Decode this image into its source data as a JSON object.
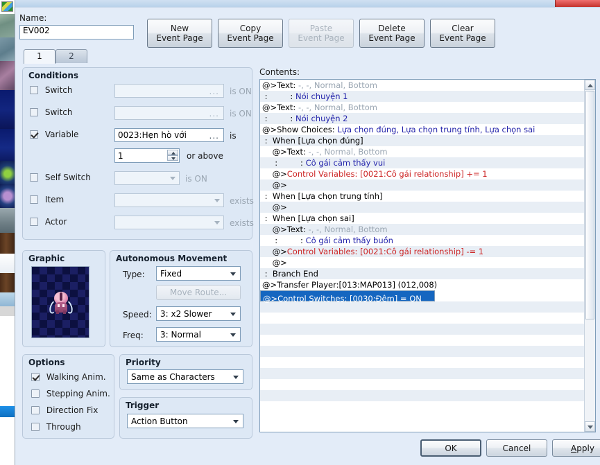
{
  "window": {
    "name_label": "Name:",
    "name_value": "EV002"
  },
  "toolbar": {
    "buttons": [
      {
        "line1": "New",
        "line2": "Event Page",
        "disabled": false
      },
      {
        "line1": "Copy",
        "line2": "Event Page",
        "disabled": false
      },
      {
        "line1": "Paste",
        "line2": "Event Page",
        "disabled": true
      },
      {
        "line1": "Delete",
        "line2": "Event Page",
        "disabled": false
      },
      {
        "line1": "Clear",
        "line2": "Event Page",
        "disabled": false
      }
    ]
  },
  "tabs": [
    {
      "label": "1",
      "active": true
    },
    {
      "label": "2",
      "active": false
    }
  ],
  "conditions": {
    "title": "Conditions",
    "rows": [
      {
        "label": "Switch",
        "checked": false,
        "value": "",
        "suffix": "is ON"
      },
      {
        "label": "Switch",
        "checked": false,
        "value": "",
        "suffix": "is ON"
      },
      {
        "label": "Variable",
        "checked": true,
        "value": "0023:Hẹn hò với",
        "suffix": "is"
      },
      {
        "label": "Self Switch",
        "checked": false,
        "value": "",
        "suffix": "is ON"
      },
      {
        "label": "Item",
        "checked": false,
        "value": "",
        "suffix": "exists"
      },
      {
        "label": "Actor",
        "checked": false,
        "value": "",
        "suffix": "exists"
      }
    ],
    "variable_amount": "1",
    "variable_comparison": "or above",
    "ellipsis": "..."
  },
  "graphic": {
    "title": "Graphic"
  },
  "movement": {
    "title": "Autonomous Movement",
    "type_label": "Type:",
    "type_value": "Fixed",
    "move_route_button": "Move Route...",
    "speed_label": "Speed:",
    "speed_value": "3: x2 Slower",
    "freq_label": "Freq:",
    "freq_value": "3: Normal"
  },
  "options": {
    "title": "Options",
    "items": [
      {
        "label": "Walking Anim.",
        "checked": true
      },
      {
        "label": "Stepping Anim.",
        "checked": false
      },
      {
        "label": "Direction Fix",
        "checked": false
      },
      {
        "label": "Through",
        "checked": false
      }
    ]
  },
  "priority": {
    "title": "Priority",
    "value": "Same as Characters"
  },
  "trigger": {
    "title": "Trigger",
    "value": "Action Button"
  },
  "contents": {
    "label": "Contents:",
    "rows": [
      {
        "segments": [
          {
            "t": "@>Text: ",
            "c": "k"
          },
          {
            "t": "-, -, Normal, Bottom",
            "c": "p"
          }
        ]
      },
      {
        "segments": [
          {
            "t": " :         : ",
            "c": "k"
          },
          {
            "t": "Nói chuyện 1",
            "c": "b"
          }
        ]
      },
      {
        "segments": [
          {
            "t": "@>Text: ",
            "c": "k"
          },
          {
            "t": "-, -, Normal, Bottom",
            "c": "p"
          }
        ]
      },
      {
        "segments": [
          {
            "t": " :         : ",
            "c": "k"
          },
          {
            "t": "Nói chuyện 2",
            "c": "b"
          }
        ]
      },
      {
        "segments": [
          {
            "t": "@>Show Choices: ",
            "c": "k"
          },
          {
            "t": "Lựa chọn đúng, Lựa chọn trung tính, Lựa chọn sai",
            "c": "b"
          }
        ]
      },
      {
        "segments": [
          {
            "t": " :  When [Lựa chọn đúng]",
            "c": "k"
          }
        ]
      },
      {
        "segments": [
          {
            "t": "    @>Text: ",
            "c": "k"
          },
          {
            "t": "-, -, Normal, Bottom",
            "c": "p"
          }
        ]
      },
      {
        "segments": [
          {
            "t": "     :         : ",
            "c": "k"
          },
          {
            "t": "Cô gái cảm thấy vui",
            "c": "b"
          }
        ]
      },
      {
        "segments": [
          {
            "t": "    @>",
            "c": "k"
          },
          {
            "t": "Control Variables: [0021:Cô gái relationship] += 1",
            "c": "r"
          }
        ]
      },
      {
        "segments": [
          {
            "t": "    @>",
            "c": "k"
          }
        ]
      },
      {
        "segments": [
          {
            "t": " :  When [Lựa chọn trung tính]",
            "c": "k"
          }
        ]
      },
      {
        "segments": [
          {
            "t": "    @>",
            "c": "k"
          }
        ]
      },
      {
        "segments": [
          {
            "t": " :  When [Lựa chọn sai]",
            "c": "k"
          }
        ]
      },
      {
        "segments": [
          {
            "t": "    @>Text: ",
            "c": "k"
          },
          {
            "t": "-, -, Normal, Bottom",
            "c": "p"
          }
        ]
      },
      {
        "segments": [
          {
            "t": "     :         : ",
            "c": "k"
          },
          {
            "t": "Cô gái cảm thấy buồn",
            "c": "b"
          }
        ]
      },
      {
        "segments": [
          {
            "t": "    @>",
            "c": "k"
          },
          {
            "t": "Control Variables: [0021:Cô gái relationship] -= 1",
            "c": "r"
          }
        ]
      },
      {
        "segments": [
          {
            "t": "    @>",
            "c": "k"
          }
        ]
      },
      {
        "segments": [
          {
            "t": " :  Branch End",
            "c": "k"
          }
        ]
      },
      {
        "segments": [
          {
            "t": "@>Transfer Player:[013:MAP013] (012,008)",
            "c": "k"
          }
        ]
      },
      {
        "selected": true,
        "segments": [
          {
            "t": "@>Control Switches: [0030:Đêm] = ON",
            "c": "k"
          }
        ]
      },
      {
        "segments": [
          {
            "t": "@>",
            "c": "k"
          }
        ]
      }
    ],
    "empty_row_count": 10
  },
  "footer": {
    "ok": "OK",
    "cancel": "Cancel",
    "apply": "Apply",
    "apply_accel": "A",
    "apply_rest": "pply"
  }
}
